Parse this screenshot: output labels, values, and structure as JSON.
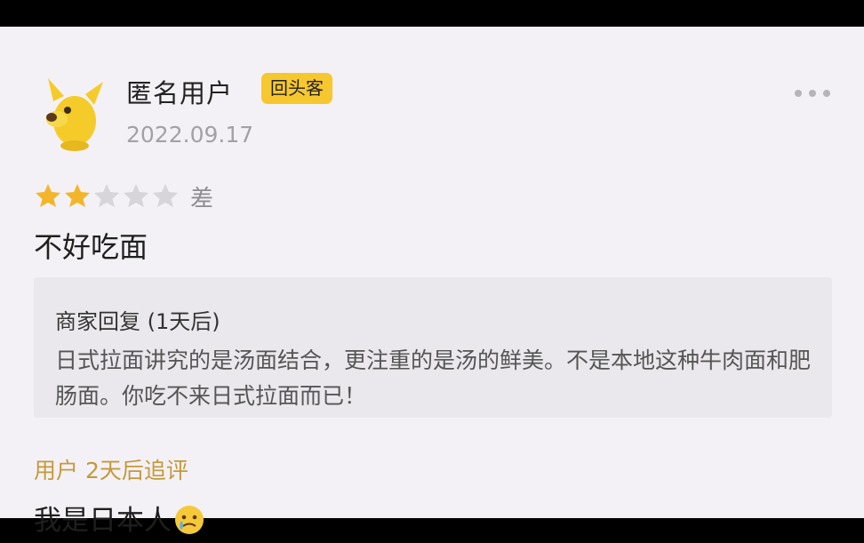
{
  "review": {
    "user": {
      "name": "匿名用户",
      "badge": "回头客",
      "date": "2022.09.17",
      "avatar_icon": "dog-mascot-icon"
    },
    "more_icon": "more-dots-icon",
    "rating": {
      "stars": 2,
      "max": 5,
      "label": "差",
      "filled_color": "#f3b62a",
      "empty_color": "#d7d4da"
    },
    "text": "不好吃面",
    "merchant_reply": {
      "title": "商家回复 (1天后)",
      "text": "日式拉面讲究的是汤面结合，更注重的是汤的鲜美。不是本地这种牛肉面和肥肠面。你吃不来日式拉面而已！"
    },
    "followup": {
      "label": "用户 2天后追评",
      "text": "我是日本人",
      "emoji_icon": "crying-face-icon"
    }
  },
  "colors": {
    "badge": "#f7c730",
    "followup_label": "#c39a3b",
    "background": "#f4f1f6"
  }
}
